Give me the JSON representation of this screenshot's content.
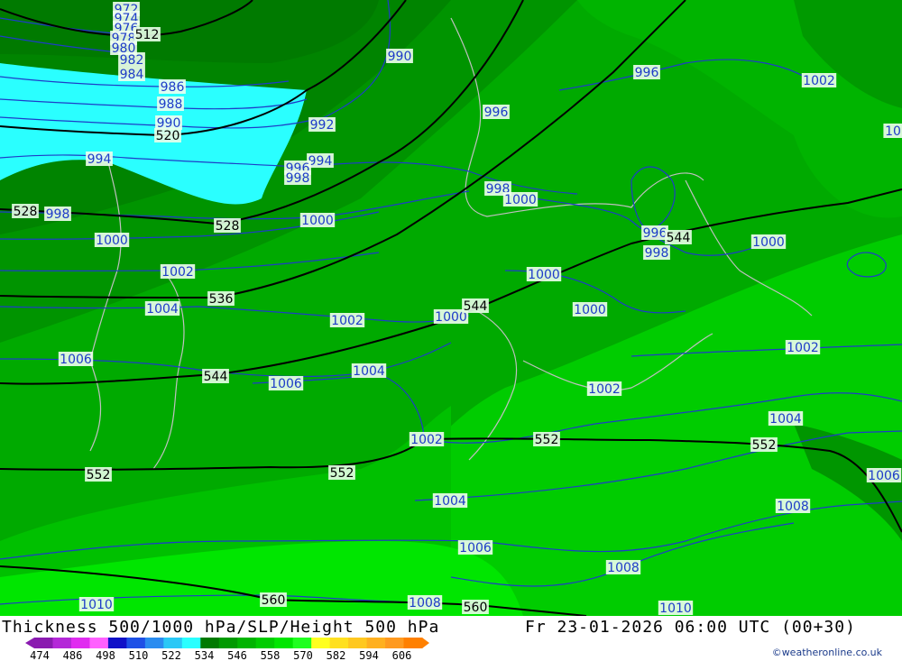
{
  "title": "Thickness 500/1000 hPa/SLP/Height 500 hPa",
  "datetime": "Fr 23-01-2026 06:00 UTC (00+30)",
  "credit": "©weatheronline.co.uk",
  "legend": {
    "ticks": [
      "474",
      "486",
      "498",
      "510",
      "522",
      "534",
      "546",
      "558",
      "570",
      "582",
      "594",
      "606"
    ],
    "colors": [
      "#8a1ab0",
      "#b428d8",
      "#e02cf0",
      "#ff60ff",
      "#1010c8",
      "#1e50e6",
      "#2a8cf0",
      "#2ac8f6",
      "#2affff",
      "#007a00",
      "#009a00",
      "#00b400",
      "#00cc00",
      "#00e600",
      "#20ff20",
      "#ffff20",
      "#ffe020",
      "#ffc820",
      "#ffb020",
      "#ff9a20",
      "#ff8000"
    ]
  },
  "colors": {
    "isobar": "#1e3cc8",
    "height_contour": "#000000",
    "coastline": "#bfbfbf"
  },
  "isobar_labels": [
    {
      "text": "972"
    },
    {
      "text": "974"
    },
    {
      "text": "976"
    },
    {
      "text": "978"
    },
    {
      "text": "980"
    },
    {
      "text": "982"
    },
    {
      "text": "984"
    },
    {
      "text": "986"
    },
    {
      "text": "988"
    },
    {
      "text": "990"
    },
    {
      "text": "990"
    },
    {
      "text": "992"
    },
    {
      "text": "994"
    },
    {
      "text": "994"
    },
    {
      "text": "996"
    },
    {
      "text": "996"
    },
    {
      "text": "996"
    },
    {
      "text": "996"
    },
    {
      "text": "998"
    },
    {
      "text": "998"
    },
    {
      "text": "998"
    },
    {
      "text": "998"
    },
    {
      "text": "1000"
    },
    {
      "text": "1000"
    },
    {
      "text": "1000"
    },
    {
      "text": "1000"
    },
    {
      "text": "1000"
    },
    {
      "text": "1000"
    },
    {
      "text": "1000"
    },
    {
      "text": "1002"
    },
    {
      "text": "1002"
    },
    {
      "text": "1002"
    },
    {
      "text": "1002"
    },
    {
      "text": "1002"
    },
    {
      "text": "1002"
    },
    {
      "text": "1004"
    },
    {
      "text": "1004"
    },
    {
      "text": "1004"
    },
    {
      "text": "1004"
    },
    {
      "text": "1006"
    },
    {
      "text": "1006"
    },
    {
      "text": "1006"
    },
    {
      "text": "1006"
    },
    {
      "text": "1008"
    },
    {
      "text": "1008"
    },
    {
      "text": "1008"
    },
    {
      "text": "1010"
    },
    {
      "text": "1010"
    },
    {
      "text": "10"
    }
  ],
  "height_labels": [
    {
      "text": "512"
    },
    {
      "text": "520"
    },
    {
      "text": "528"
    },
    {
      "text": "528"
    },
    {
      "text": "536"
    },
    {
      "text": "544"
    },
    {
      "text": "544"
    },
    {
      "text": "544"
    },
    {
      "text": "552"
    },
    {
      "text": "552"
    },
    {
      "text": "552"
    },
    {
      "text": "552"
    },
    {
      "text": "560"
    },
    {
      "text": "560"
    }
  ]
}
